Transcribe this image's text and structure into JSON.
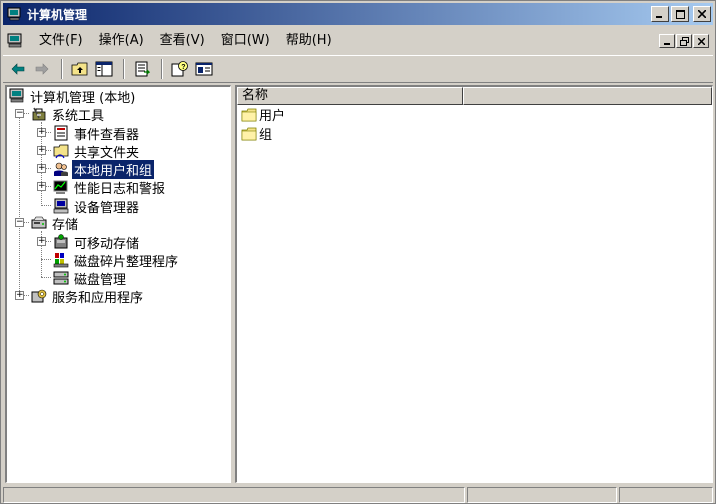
{
  "window": {
    "title": "计算机管理"
  },
  "menu": {
    "items": [
      "文件(F)",
      "操作(A)",
      "查看(V)",
      "窗口(W)",
      "帮助(H)"
    ]
  },
  "toolbar": {
    "icons": [
      "back-arrow-icon",
      "forward-arrow-icon",
      "up-folder-icon",
      "show-hide-tree-icon",
      "export-list-icon",
      "help-icon",
      "view-icon"
    ]
  },
  "tree": {
    "root": "计算机管理 (本地)",
    "system_tools": "系统工具",
    "event_viewer": "事件查看器",
    "shared_folders": "共享文件夹",
    "local_users_groups": "本地用户和组",
    "perf_logs": "性能日志和警报",
    "device_manager": "设备管理器",
    "storage": "存储",
    "removable_storage": "可移动存储",
    "defrag": "磁盘碎片整理程序",
    "disk_mgmt": "磁盘管理",
    "services_apps": "服务和应用程序"
  },
  "list": {
    "header": "名称",
    "items": [
      "用户",
      "组"
    ]
  },
  "colors": {
    "selection": "#0a246a",
    "title_start": "#0a246a",
    "title_end": "#a6caf0",
    "face": "#d4d0c8"
  }
}
